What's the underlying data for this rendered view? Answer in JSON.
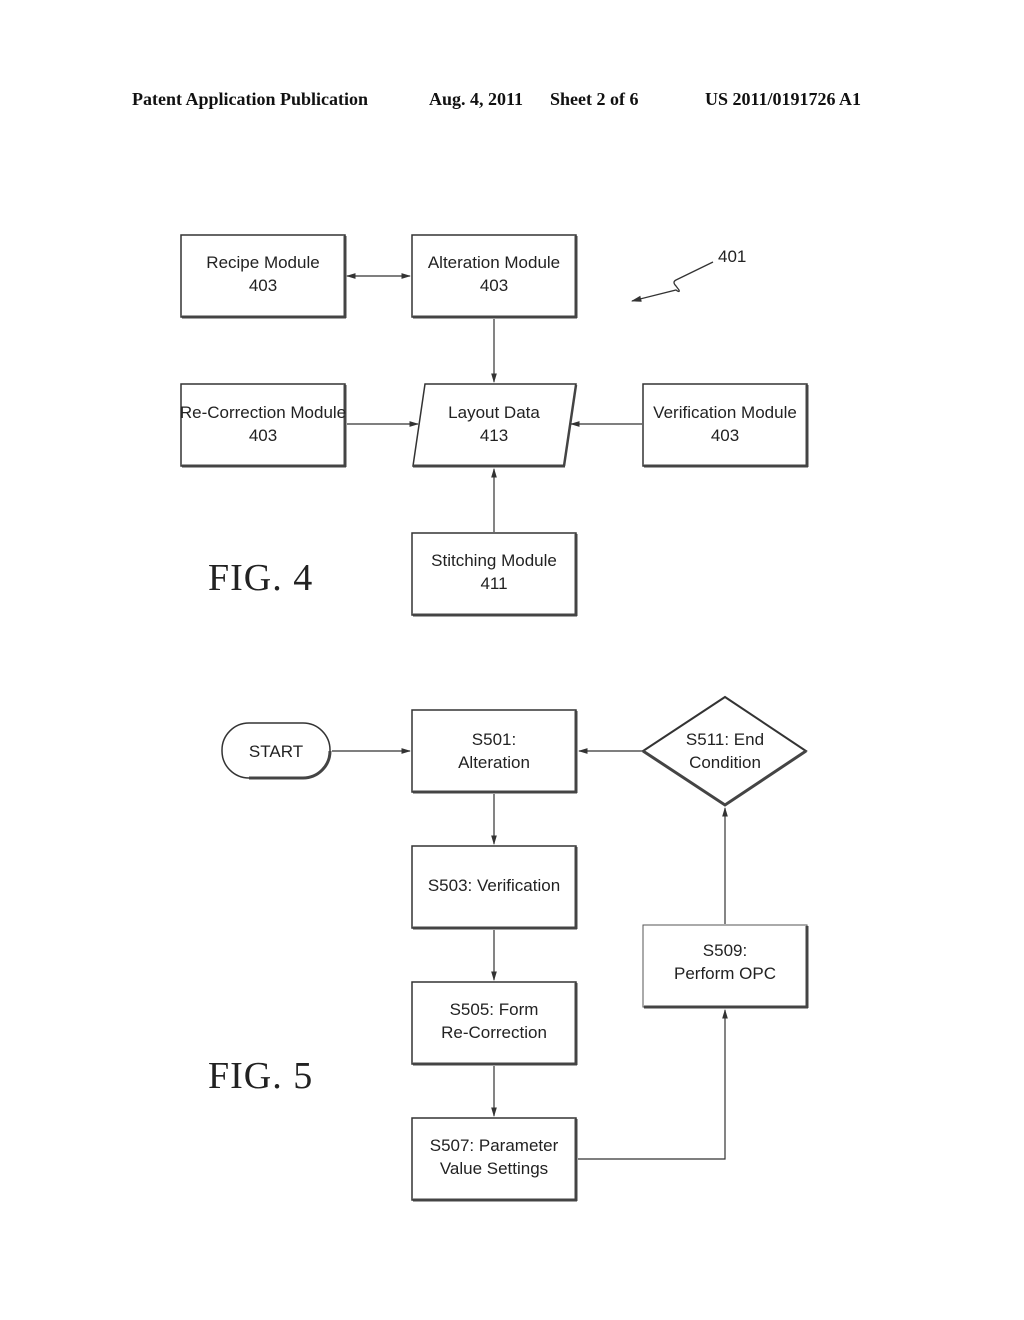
{
  "header": {
    "publication": "Patent Application Publication",
    "date": "Aug. 4, 2011",
    "sheet": "Sheet 2 of 6",
    "number": "US 2011/0191726 A1"
  },
  "fig4": {
    "label": "FIG. 4",
    "reference": "401",
    "nodes": {
      "recipe": {
        "line1": "Recipe Module",
        "line2": "403"
      },
      "alteration": {
        "line1": "Alteration Module",
        "line2": "403"
      },
      "recorrection": {
        "line1": "Re-Correction Module",
        "line2": "403"
      },
      "layout": {
        "line1": "Layout Data",
        "line2": "413"
      },
      "verification": {
        "line1": "Verification Module",
        "line2": "403"
      },
      "stitching": {
        "line1": "Stitching Module",
        "line2": "411"
      }
    },
    "edges": [
      {
        "from": "recipe",
        "to": "alteration",
        "bidirectional": true
      },
      {
        "from": "alteration",
        "to": "layout"
      },
      {
        "from": "recorrection",
        "to": "layout"
      },
      {
        "from": "verification",
        "to": "layout"
      },
      {
        "from": "stitching",
        "to": "layout"
      }
    ]
  },
  "fig5": {
    "label": "FIG. 5",
    "nodes": {
      "start": {
        "line1": "START"
      },
      "s501": {
        "line1": "S501:",
        "line2": "Alteration"
      },
      "s503": {
        "line1": "S503: Verification"
      },
      "s505": {
        "line1": "S505: Form",
        "line2": "Re-Correction"
      },
      "s507": {
        "line1": "S507: Parameter",
        "line2": "Value Settings"
      },
      "s509": {
        "line1": "S509:",
        "line2": "Perform OPC"
      },
      "s511": {
        "line1": "S511: End",
        "line2": "Condition"
      }
    },
    "edges": [
      {
        "from": "start",
        "to": "s501"
      },
      {
        "from": "s501",
        "to": "s503"
      },
      {
        "from": "s503",
        "to": "s505"
      },
      {
        "from": "s505",
        "to": "s507"
      },
      {
        "from": "s507",
        "to": "s509"
      },
      {
        "from": "s509",
        "to": "s511"
      },
      {
        "from": "s511",
        "to": "s501"
      }
    ]
  }
}
